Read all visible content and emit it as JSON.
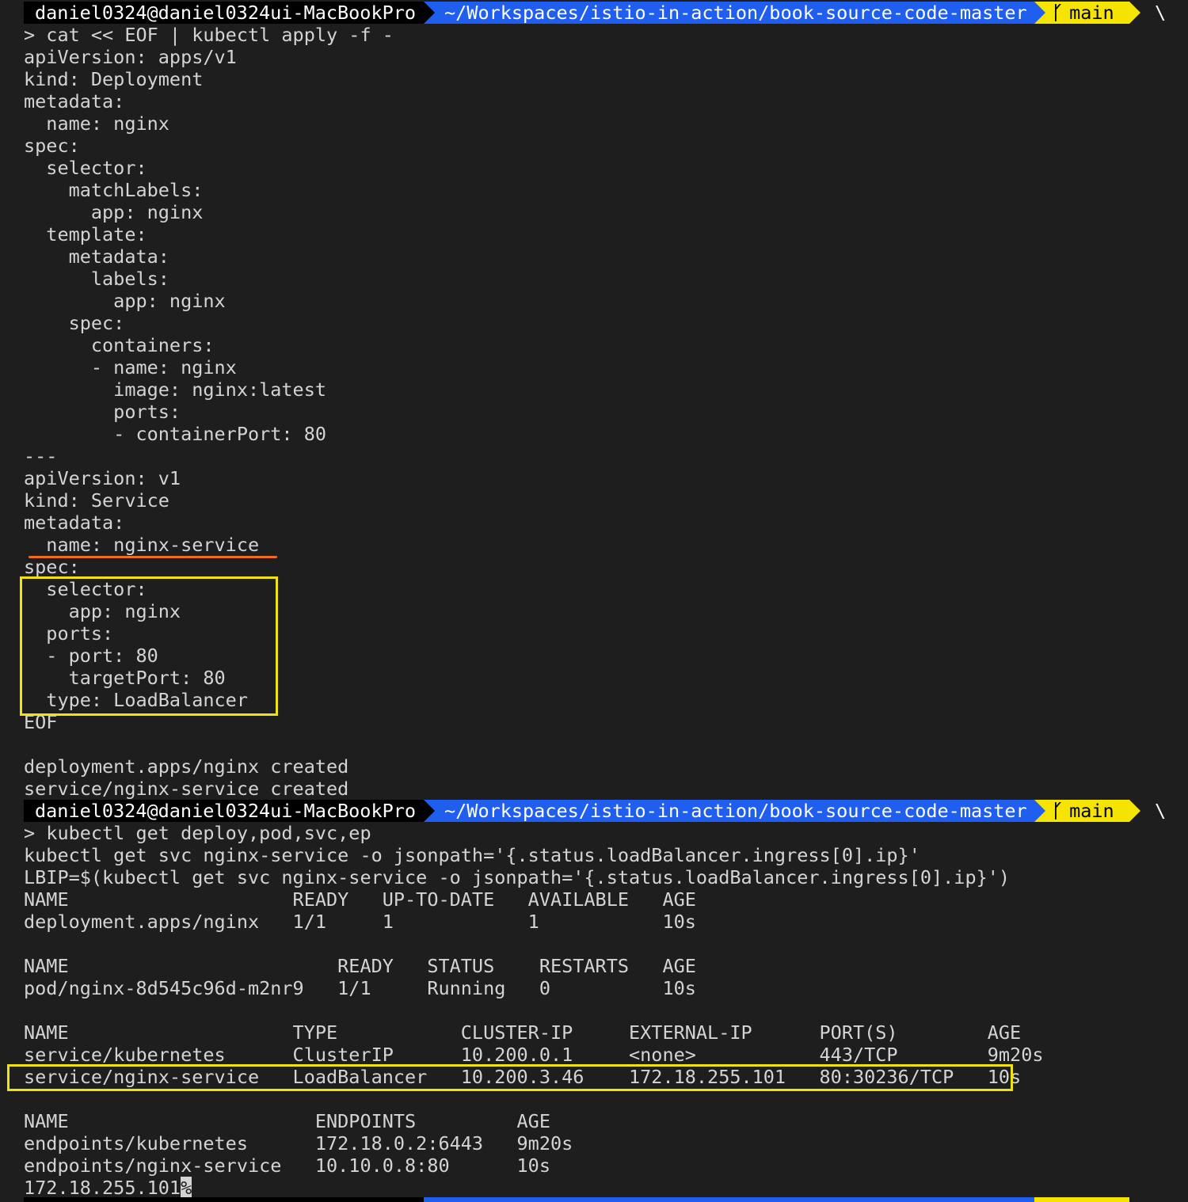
{
  "prompt1": {
    "user_host": "daniel0324@daniel0324ui-MacBookPro",
    "path": "~/Workspaces/istio-in-action/book-source-code-master",
    "branch_icon": "git-branch-icon",
    "branch": "main",
    "continuation": "\\"
  },
  "block1": {
    "lines": [
      "> cat << EOF | kubectl apply -f -",
      "apiVersion: apps/v1",
      "kind: Deployment",
      "metadata:",
      "  name: nginx",
      "spec:",
      "  selector:",
      "    matchLabels:",
      "      app: nginx",
      "  template:",
      "    metadata:",
      "      labels:",
      "        app: nginx",
      "    spec:",
      "      containers:",
      "      - name: nginx",
      "        image: nginx:latest",
      "        ports:",
      "        - containerPort: 80",
      "---",
      "apiVersion: v1",
      "kind: Service",
      "metadata:",
      "  name: nginx-service",
      "spec:",
      "  selector:",
      "    app: nginx",
      "  ports:",
      "  - port: 80",
      "    targetPort: 80",
      "  type: LoadBalancer",
      "EOF",
      "",
      "deployment.apps/nginx created",
      "service/nginx-service created"
    ]
  },
  "prompt2": {
    "user_host": "daniel0324@daniel0324ui-MacBookPro",
    "path": "~/Workspaces/istio-in-action/book-source-code-master",
    "branch_icon": "git-branch-icon",
    "branch": "main",
    "continuation": "\\"
  },
  "block2": {
    "lines": [
      "> kubectl get deploy,pod,svc,ep",
      "kubectl get svc nginx-service -o jsonpath='{.status.loadBalancer.ingress[0].ip}'",
      "LBIP=$(kubectl get svc nginx-service -o jsonpath='{.status.loadBalancer.ingress[0].ip}')",
      "NAME                    READY   UP-TO-DATE   AVAILABLE   AGE",
      "deployment.apps/nginx   1/1     1            1           10s",
      "",
      "NAME                        READY   STATUS    RESTARTS   AGE",
      "pod/nginx-8d545c96d-m2nr9   1/1     Running   0          10s",
      "",
      "NAME                    TYPE           CLUSTER-IP     EXTERNAL-IP      PORT(S)        AGE",
      "service/kubernetes      ClusterIP      10.200.0.1     <none>           443/TCP        9m20s",
      "service/nginx-service   LoadBalancer   10.200.3.46    172.18.255.101   80:30236/TCP   10s",
      "",
      "NAME                      ENDPOINTS         AGE",
      "endpoints/kubernetes      172.18.0.2:6443   9m20s",
      "endpoints/nginx-service   10.10.0.8:80      10s"
    ],
    "final_output": "172.18.255.101",
    "cursor_glyph": "%"
  },
  "colors": {
    "background": "#1e1e1e",
    "text": "#d4d4d4",
    "prompt_user_bg": "#000000",
    "prompt_path_bg": "#1f5eef",
    "prompt_git_bg": "#f5e400",
    "highlight_box": "#f2e20b",
    "underline": "#f26a1b"
  }
}
